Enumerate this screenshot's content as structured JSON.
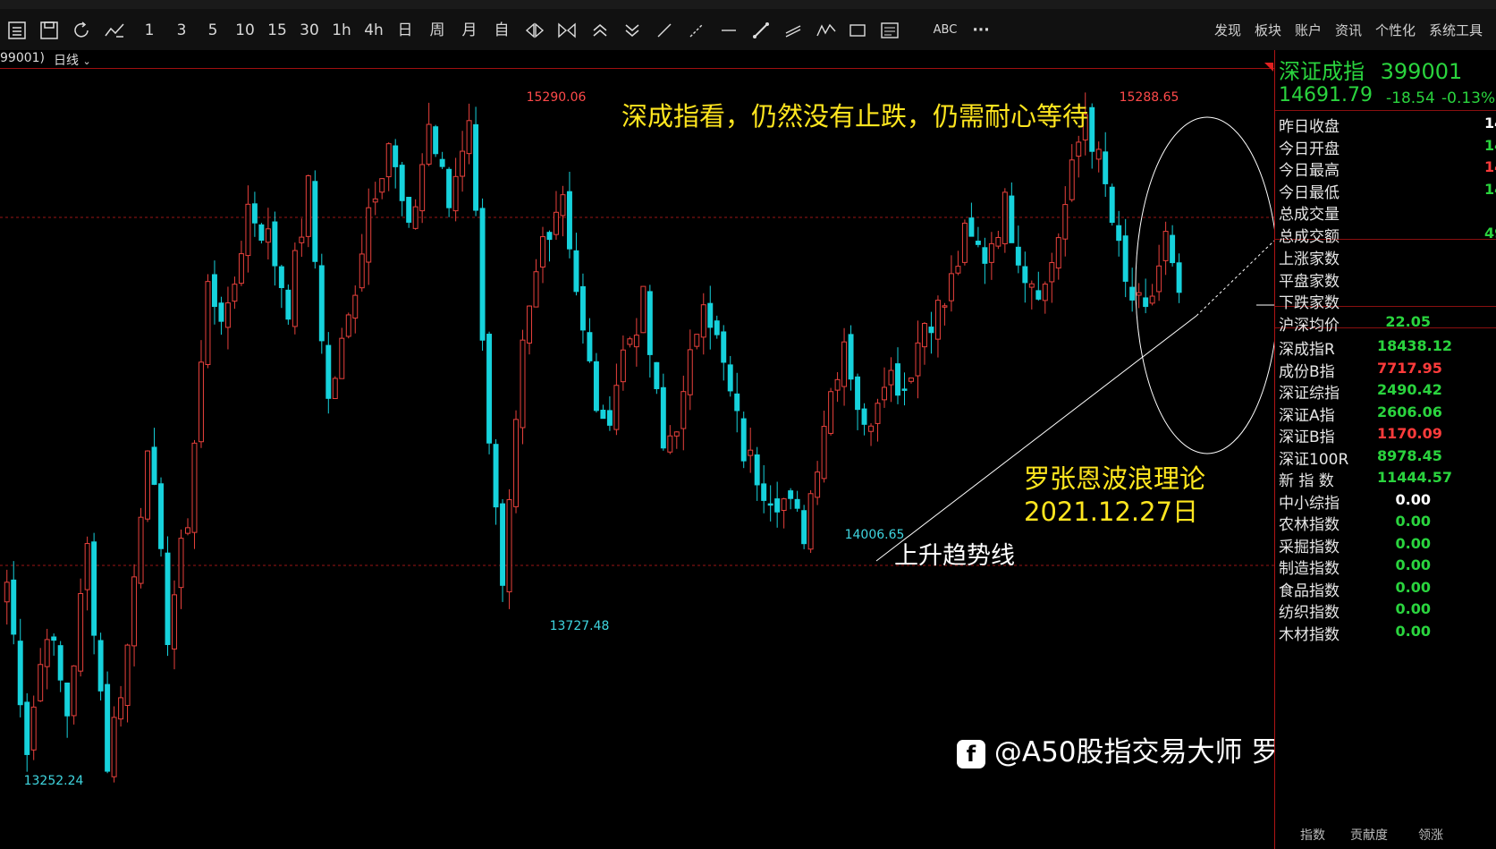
{
  "toolbar": {
    "periods": [
      "1",
      "3",
      "5",
      "10",
      "15",
      "30",
      "1h",
      "4h",
      "日",
      "周",
      "月",
      "自"
    ],
    "draw_tool_text": "ABC",
    "more_label": "···",
    "menu": [
      "发现",
      "板块",
      "账户",
      "资讯",
      "个性化",
      "系统工具"
    ]
  },
  "subbar": {
    "code_fragment": "99001)",
    "period_label": "日线"
  },
  "side": {
    "name": "深证成指",
    "code": "399001",
    "price": "14691.79",
    "change": "-18.54",
    "change_pct": "-0.13%",
    "quote_rows": [
      {
        "label": "昨日收盘",
        "value": "14",
        "color": "#ffffff"
      },
      {
        "label": "今日开盘",
        "value": "14",
        "color": "#2ad43e"
      },
      {
        "label": "今日最高",
        "value": "14",
        "color": "#ff3b3b"
      },
      {
        "label": "今日最低",
        "value": "14",
        "color": "#2ad43e"
      },
      {
        "label": "总成交量",
        "value": "",
        "color": "#ffffff"
      },
      {
        "label": "总成交额",
        "value": "49",
        "color": "#2ad43e"
      }
    ],
    "breadth_rows": [
      {
        "label": "上涨家数",
        "value": "",
        "color": "#ffffff"
      },
      {
        "label": "平盘家数",
        "value": "",
        "color": "#ffffff"
      },
      {
        "label": "下跌家数",
        "value": "",
        "color": "#ffffff"
      }
    ],
    "avg_row": {
      "label": "沪深均价",
      "value": "22.05",
      "color": "#2ad43e"
    },
    "index_rows": [
      {
        "label": "深成指R",
        "value": "18438.12",
        "color": "#2ad43e"
      },
      {
        "label": "成份B指",
        "value": "7717.95",
        "color": "#ff3b3b"
      },
      {
        "label": "深证综指",
        "value": "2490.42",
        "color": "#2ad43e"
      },
      {
        "label": "深证A指",
        "value": "2606.06",
        "color": "#2ad43e"
      },
      {
        "label": "深证B指",
        "value": "1170.09",
        "color": "#ff3b3b"
      },
      {
        "label": "深证100R",
        "value": "8978.45",
        "color": "#2ad43e"
      },
      {
        "label": "新 指 数",
        "value": "11444.57",
        "color": "#2ad43e"
      },
      {
        "label": "中小综指",
        "value": "0.00",
        "color": "#ffffff"
      },
      {
        "label": "农林指数",
        "value": "0.00",
        "color": "#2ad43e"
      },
      {
        "label": "采掘指数",
        "value": "0.00",
        "color": "#2ad43e"
      },
      {
        "label": "制造指数",
        "value": "0.00",
        "color": "#2ad43e"
      },
      {
        "label": "食品指数",
        "value": "0.00",
        "color": "#2ad43e"
      },
      {
        "label": "纺织指数",
        "value": "0.00",
        "color": "#2ad43e"
      },
      {
        "label": "木材指数",
        "value": "0.00",
        "color": "#2ad43e"
      }
    ],
    "tabs": [
      "指数",
      "贡献度",
      "领涨"
    ]
  },
  "annotations": {
    "headline": "深成指看，仍然没有止跌，仍需耐心等待",
    "theory": "罗张恩波浪理论",
    "date": "2021.12.27日",
    "trendline": "上升趋势线",
    "watermark": "@A50股指交易大师 罗张恩波浪理论"
  },
  "colors": {
    "up": "#e8413c",
    "down": "#16d2dc",
    "accent_yellow": "#ffe61f",
    "panel_green": "#2ad43e"
  },
  "chart_data": {
    "type": "candlestick",
    "price_labels": [
      "15290.06",
      "15288.65",
      "13727.48",
      "14006.65",
      "13252.24"
    ],
    "extremes": [
      {
        "label": "15290.06",
        "value": 15290.06,
        "kind": "high"
      },
      {
        "label": "15288.65",
        "value": 15288.65,
        "kind": "high"
      },
      {
        "label": "13727.48",
        "value": 13727.48,
        "kind": "low"
      },
      {
        "label": "14006.65",
        "value": 14006.65,
        "kind": "low"
      },
      {
        "label": "13252.24",
        "value": 13252.24,
        "kind": "low"
      }
    ],
    "last_close": 14691.79,
    "ylim": [
      13230,
      15370
    ]
  }
}
